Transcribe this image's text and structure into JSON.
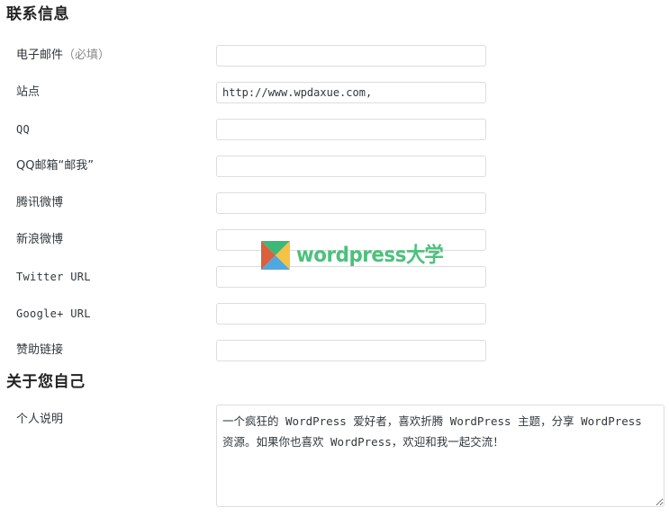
{
  "sections": {
    "contact": {
      "heading": "联系信息",
      "rows": [
        {
          "name": "email",
          "label": "电子邮件",
          "label_hint": "（必填）",
          "mono": false,
          "value": "",
          "placeholder": ""
        },
        {
          "name": "website",
          "label": "站点",
          "label_hint": "",
          "mono": false,
          "value": "http://www.wpdaxue.com,",
          "placeholder": ""
        },
        {
          "name": "qq",
          "label": "QQ",
          "label_hint": "",
          "mono": true,
          "value": "",
          "placeholder": ""
        },
        {
          "name": "qq-mail",
          "label": "QQ邮箱“邮我”",
          "label_hint": "",
          "mono": false,
          "value": "",
          "placeholder": ""
        },
        {
          "name": "tencent-weibo",
          "label": "腾讯微博",
          "label_hint": "",
          "mono": false,
          "value": "",
          "placeholder": ""
        },
        {
          "name": "sina-weibo",
          "label": "新浪微博",
          "label_hint": "",
          "mono": false,
          "value": "",
          "placeholder": ""
        },
        {
          "name": "twitter-url",
          "label": "Twitter URL",
          "label_hint": "",
          "mono": true,
          "value": "",
          "placeholder": ""
        },
        {
          "name": "google-plus-url",
          "label": "Google+ URL",
          "label_hint": "",
          "mono": true,
          "value": "",
          "placeholder": ""
        },
        {
          "name": "sponsor-link",
          "label": "赞助链接",
          "label_hint": "",
          "mono": false,
          "value": "",
          "placeholder": ""
        }
      ]
    },
    "about": {
      "heading": "关于您自己",
      "bio_label": "个人说明",
      "bio_value": "一个疯狂的 WordPress 爱好者，喜欢折腾 WordPress 主题，分享 WordPress 资源。如果你也喜欢 WordPress，欢迎和我一起交流！",
      "bio_placeholder": ""
    }
  },
  "watermark": {
    "icon": "wordpress-daxue-logo-icon",
    "text_latin": "wordpress",
    "text_cjk": "大学",
    "colors": {
      "top": "#3cb878",
      "bottom": "#4fa8e0",
      "left": "#d9613c",
      "right": "#f6c243",
      "text": "#4cc17c"
    }
  },
  "colors": {
    "input_border": "#dddddd",
    "text": "#32373c",
    "heading": "#222222",
    "hint": "#8a8a8a"
  }
}
